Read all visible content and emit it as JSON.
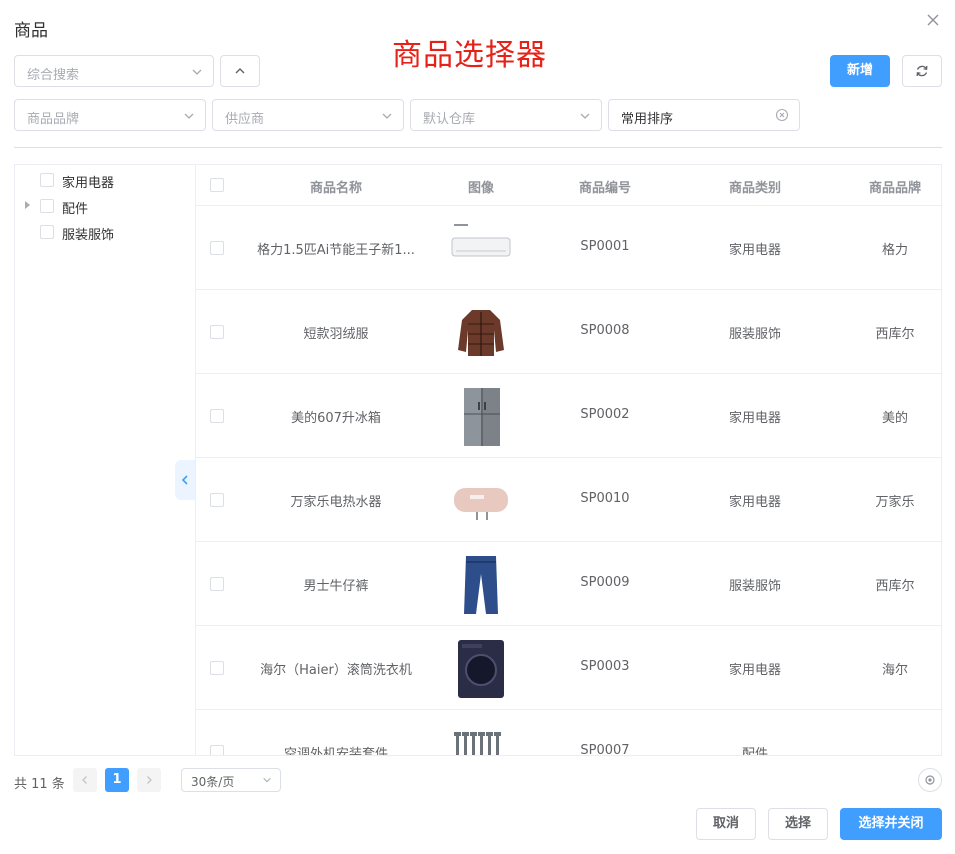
{
  "dialog": {
    "title": "商品",
    "heading": "商品选择器"
  },
  "filters": {
    "search_placeholder": "综合搜索",
    "brand_placeholder": "商品品牌",
    "supplier_placeholder": "供应商",
    "warehouse_placeholder": "默认仓库",
    "sort_value": "常用排序"
  },
  "toolbar": {
    "add_label": "新增"
  },
  "tree": [
    {
      "label": "家用电器",
      "expandable": false
    },
    {
      "label": "配件",
      "expandable": true
    },
    {
      "label": "服装服饰",
      "expandable": false
    }
  ],
  "table": {
    "headers": {
      "name": "商品名称",
      "image": "图像",
      "code": "商品编号",
      "category": "商品类别",
      "brand": "商品品牌"
    },
    "rows": [
      {
        "name": "格力1.5匹Ai节能王子新1...",
        "image": "air-conditioner",
        "code": "SP0001",
        "category": "家用电器",
        "brand": "格力"
      },
      {
        "name": "短款羽绒服",
        "image": "down-jacket",
        "code": "SP0008",
        "category": "服装服饰",
        "brand": "西库尔"
      },
      {
        "name": "美的607升冰箱",
        "image": "refrigerator",
        "code": "SP0002",
        "category": "家用电器",
        "brand": "美的"
      },
      {
        "name": "万家乐电热水器",
        "image": "water-heater",
        "code": "SP0010",
        "category": "家用电器",
        "brand": "万家乐"
      },
      {
        "name": "男士牛仔裤",
        "image": "jeans",
        "code": "SP0009",
        "category": "服装服饰",
        "brand": "西库尔"
      },
      {
        "name": "海尔（Haier）滚筒洗衣机",
        "image": "washing-machine",
        "code": "SP0003",
        "category": "家用电器",
        "brand": "海尔"
      },
      {
        "name": "空调外机安装套件",
        "image": "install-kit",
        "code": "SP0007",
        "category": "配件",
        "brand": ""
      }
    ]
  },
  "pagination": {
    "total": "共 11 条",
    "current": "1",
    "page_size": "30条/页"
  },
  "footer": {
    "cancel": "取消",
    "select": "选择",
    "select_close": "选择并关闭"
  },
  "colors": {
    "primary": "#409eff",
    "heading": "#e62117",
    "border": "#dcdfe6"
  }
}
